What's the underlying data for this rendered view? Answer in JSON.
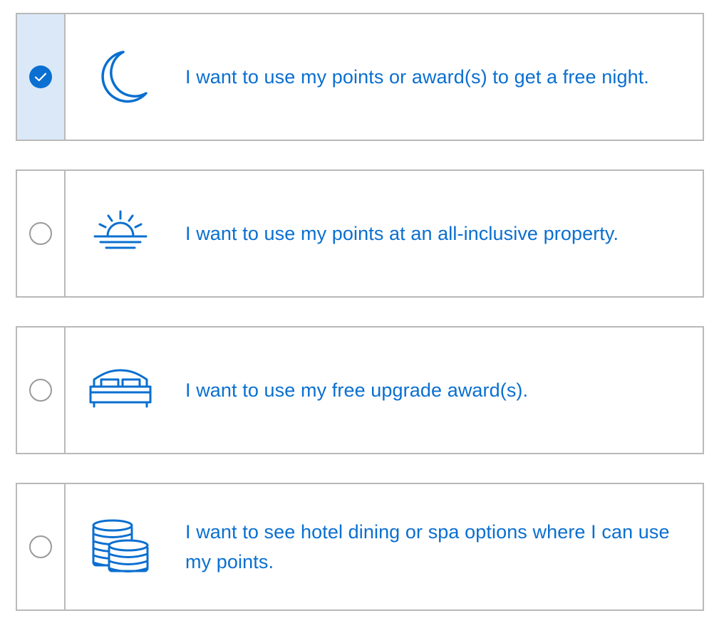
{
  "colors": {
    "accent": "#0a6fd0",
    "selected_background": "#dbe8f8",
    "border": "#b9b9b9"
  },
  "options": [
    {
      "label": "I want to use my points or award(s) to get a free night.",
      "icon": "moon-icon",
      "selected": true
    },
    {
      "label": "I want to use my points at an all-inclusive property.",
      "icon": "sunset-icon",
      "selected": false
    },
    {
      "label": "I want to use my free upgrade award(s).",
      "icon": "bed-icon",
      "selected": false
    },
    {
      "label": "I want to see hotel dining or spa options where I can use my points.",
      "icon": "coins-icon",
      "selected": false
    }
  ]
}
